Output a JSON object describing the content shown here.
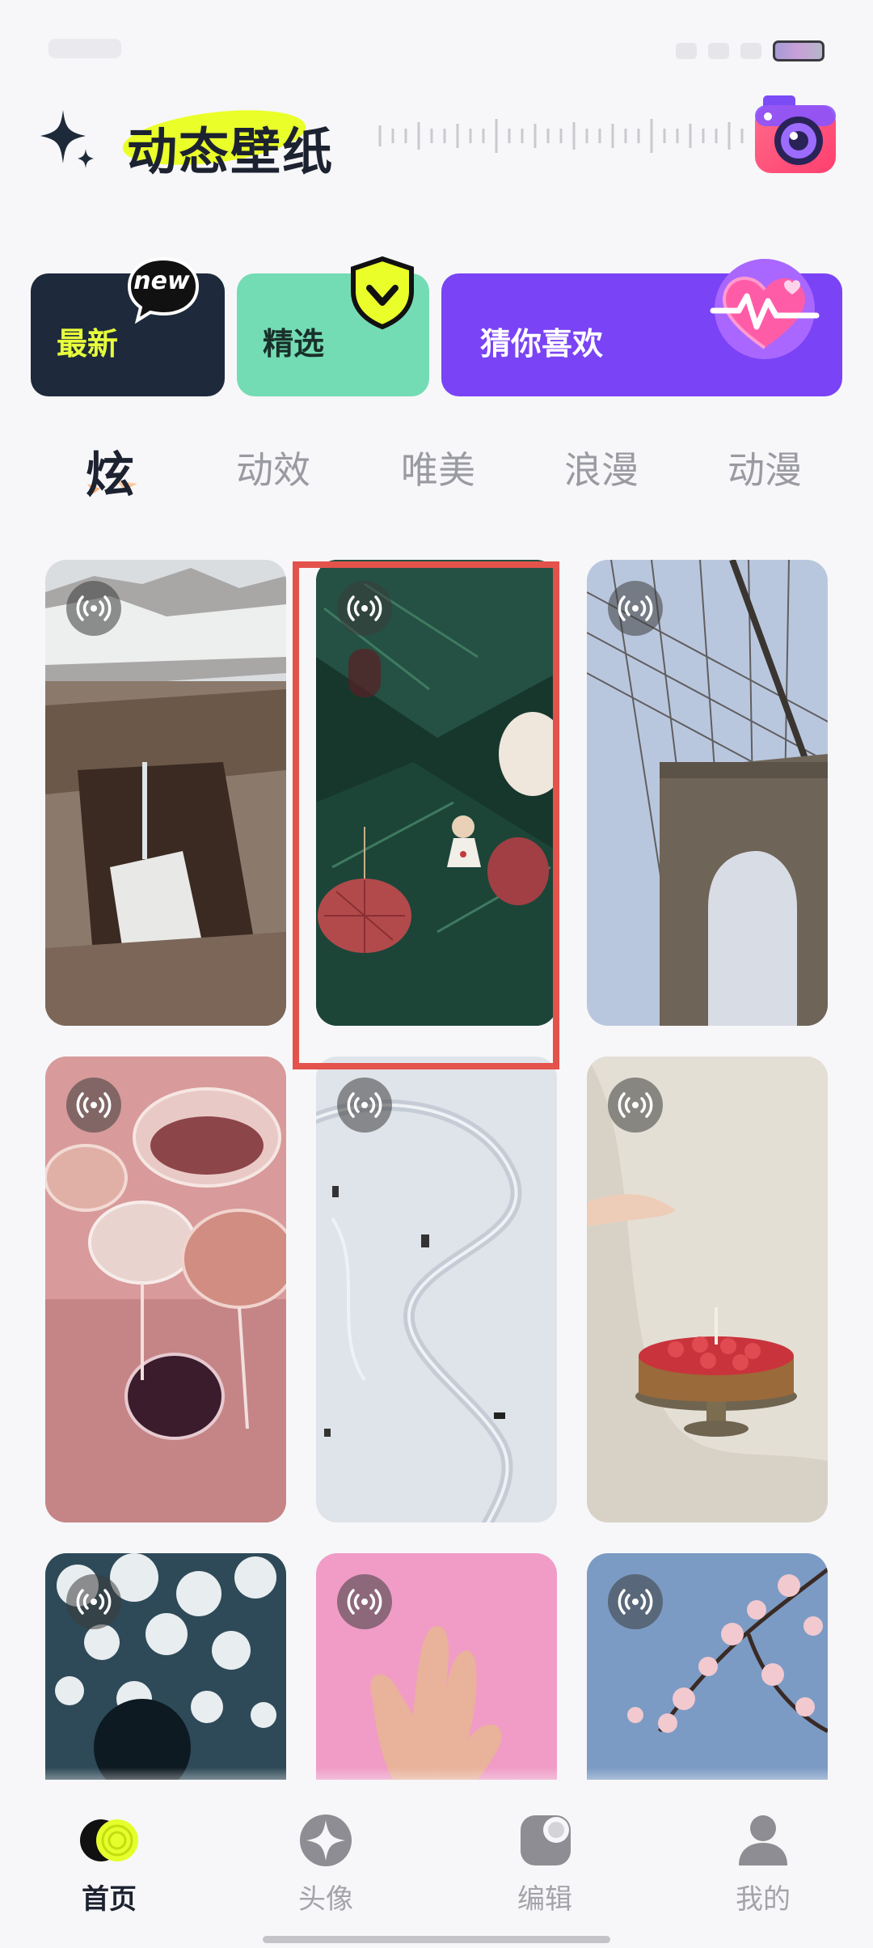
{
  "app": {
    "title": "动态壁纸"
  },
  "cards": {
    "newest": "最新",
    "newest_badge": "new",
    "featured": "精选",
    "guess": "猜你喜欢"
  },
  "tabs": [
    "炫",
    "动效",
    "唯美",
    "浪漫",
    "动漫"
  ],
  "active_tab": "炫",
  "wallpapers": [
    {
      "subject": "mountain canyon waterfall",
      "live": true
    },
    {
      "subject": "christmas tree ornaments",
      "live": true,
      "selected": true
    },
    {
      "subject": "bridge cables",
      "live": true
    },
    {
      "subject": "wine glasses",
      "live": true
    },
    {
      "subject": "snowy road aerial",
      "live": true
    },
    {
      "subject": "strawberry cake with candle",
      "live": true
    },
    {
      "subject": "white flowers",
      "live": true
    },
    {
      "subject": "hand on pink",
      "live": true
    },
    {
      "subject": "cherry blossoms",
      "live": true
    }
  ],
  "nav": [
    {
      "label": "首页",
      "active": true
    },
    {
      "label": "头像",
      "active": false
    },
    {
      "label": "编辑",
      "active": false
    },
    {
      "label": "我的",
      "active": false
    }
  ],
  "colors": {
    "accent_yellow": "#eaff2a",
    "purple": "#7a43f5",
    "mint": "#74dcb4",
    "navy": "#1e2a3c",
    "selection_red": "#e4524c"
  }
}
